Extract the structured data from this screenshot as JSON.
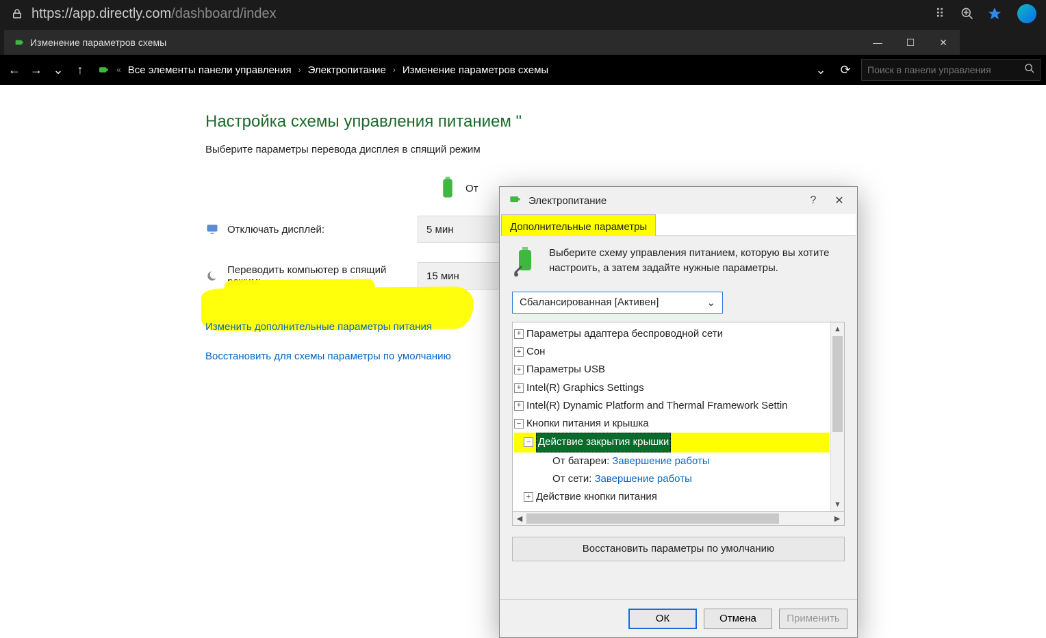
{
  "browser": {
    "url_host": "https://app.directly.com",
    "url_path": "/dashboard/index"
  },
  "tab": {
    "title": "Изменение параметров схемы"
  },
  "cp_nav": {
    "root": "Все элементы панели управления",
    "mid": "Электропитание",
    "leaf": "Изменение параметров схемы",
    "search_placeholder": "Поиск в панели управления"
  },
  "page": {
    "heading": "Настройка схемы управления питанием \"",
    "desc": "Выберите параметры перевода дисплея в спящий режим",
    "ot": "От",
    "row1_label": "Отключать дисплей:",
    "row1_value": "5 мин",
    "row2_label": "Переводить компьютер в спящий режим:",
    "row2_value": "15 мин",
    "link1": "Изменить дополнительные параметры питания",
    "link2": "Восстановить для схемы параметры по умолчанию"
  },
  "dialog": {
    "title": "Электропитание",
    "tab": "Дополнительные параметры",
    "intro": "Выберите схему управления питанием, которую вы хотите настроить, а затем задайте нужные параметры.",
    "plan": "Сбалансированная [Активен]",
    "tree": {
      "n1": "Параметры адаптера беспроводной сети",
      "n2": "Сон",
      "n3": "Параметры USB",
      "n4": "Intel(R) Graphics Settings",
      "n5": "Intel(R) Dynamic Platform and Thermal Framework Settin",
      "n6": "Кнопки питания и крышка",
      "n6a": "Действие закрытия крышки",
      "n6a1_lbl": "От батареи: ",
      "n6a1_val": "Завершение работы",
      "n6a2_lbl": "От сети: ",
      "n6a2_val": "Завершение работы",
      "n6b": "Действие кнопки питания"
    },
    "restore": "Восстановить параметры по умолчанию",
    "ok": "ОК",
    "cancel": "Отмена",
    "apply": "Применить"
  }
}
